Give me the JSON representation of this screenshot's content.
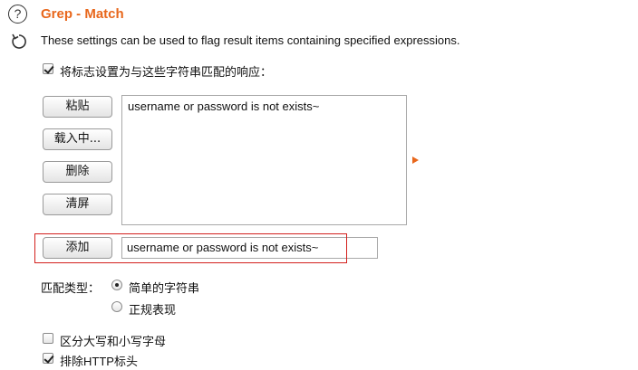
{
  "header": {
    "title": "Grep - Match",
    "description": "These settings can be used to flag result items containing specified expressions.",
    "help_glyph": "?",
    "icons": [
      "help-icon",
      "refresh-icon"
    ]
  },
  "flag_checkbox": {
    "label": "将标志设置为与这些字符串匹配的响应：",
    "checked": true
  },
  "buttons": {
    "paste": "粘贴",
    "load": "载入中...",
    "remove": "删除",
    "clear": "清屏",
    "add": "添加"
  },
  "list": {
    "items": [
      "username or password is not exists~"
    ]
  },
  "add_input": {
    "value": "username or password is not exists~"
  },
  "match_type": {
    "label": "匹配类型：",
    "options": [
      {
        "label": "简单的字符串",
        "selected": true
      },
      {
        "label": "正规表现",
        "selected": false
      }
    ]
  },
  "case_checkbox": {
    "label": "区分大写和小写字母",
    "checked": false
  },
  "exclude_http_checkbox": {
    "label": "排除HTTP标头",
    "checked": true
  },
  "colors": {
    "accent": "#e8671c",
    "highlight_border": "#d3201d"
  }
}
